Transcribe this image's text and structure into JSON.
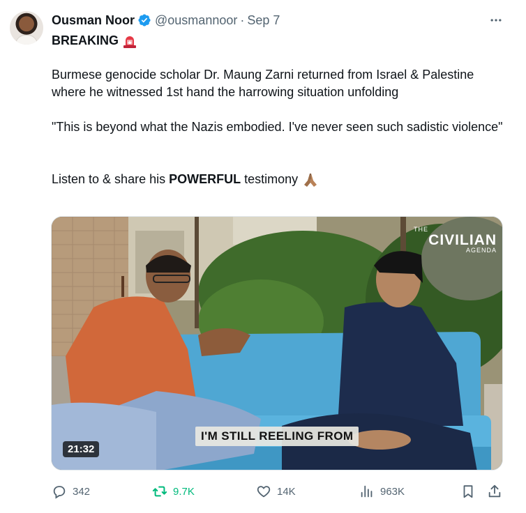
{
  "tweet": {
    "author": {
      "display_name": "Ousman Noor",
      "handle": "@ousmannoor",
      "separator": "·",
      "date": "Sep 7",
      "verified": true
    },
    "more_icon": "more-horizontal-icon",
    "lines": {
      "breaking": "BREAKING",
      "breaking_emoji": "siren-emoji",
      "paragraph1": "Burmese genocide scholar Dr. Maung Zarni returned from Israel & Palestine where he witnessed 1st hand the harrowing situation unfolding",
      "paragraph2": "\"This is beyond what the Nazis embodied. I've never seen such sadistic violence\"",
      "paragraph3_prefix": "Listen to & share his ",
      "paragraph3_bold": "POWERFUL",
      "paragraph3_suffix": " testimony",
      "paragraph3_emoji": "folded-hands-emoji"
    },
    "video": {
      "logo_top": "THE",
      "logo_main": "CIVILIAN",
      "logo_sub": "AGENDA",
      "caption": "I'M STILL REELING FROM",
      "duration": "21:32"
    },
    "actions": {
      "replies": "342",
      "retweets": "9.7K",
      "likes": "14K",
      "views": "963K"
    },
    "colors": {
      "verified": "#1d9bf0",
      "retweet_active": "#00ba7c",
      "muted": "#536471",
      "text": "#0f1419"
    }
  }
}
